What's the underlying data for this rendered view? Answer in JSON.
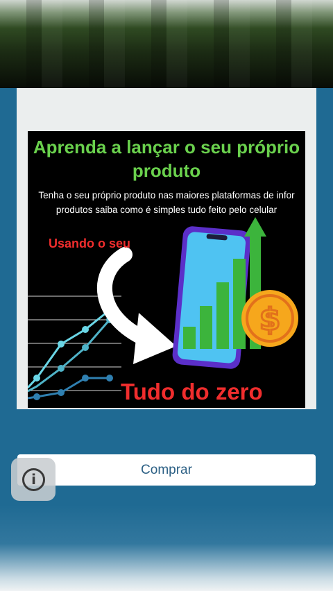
{
  "ad": {
    "headline": "Aprenda a lançar o seu próprio produto",
    "subtitle": "Tenha o seu próprio produto nas maiores plataformas de infor produtos saiba como é simples tudo feito pelo celular",
    "using_label": "Usando o seu",
    "footer": "Tudo do zero",
    "colors": {
      "headline": "#6ad14d",
      "accent_red": "#f02d2d",
      "bars": "#3cb43c",
      "phone": "#4fc3f2",
      "coin": "#f6a71c"
    },
    "icons": [
      "phone-icon",
      "growth-bars-icon",
      "up-arrow-icon",
      "dollar-coin-icon",
      "curved-arrow-icon",
      "line-chart-graphic"
    ]
  },
  "actions": {
    "buy_label": "Comprar"
  },
  "info": {
    "icon": "info-icon",
    "glyph": "i"
  }
}
